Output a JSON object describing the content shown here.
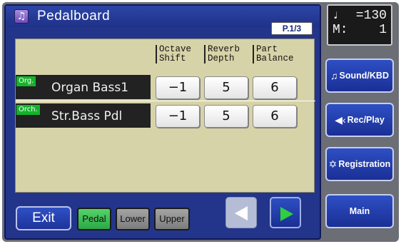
{
  "header": {
    "title": "Pedalboard",
    "page": "P.1/3",
    "icon": "music-note-icon"
  },
  "columns": [
    {
      "line1": "Octave",
      "line2": "Shift"
    },
    {
      "line1": "Reverb",
      "line2": "Depth"
    },
    {
      "line1": "Part",
      "line2": "Balance"
    }
  ],
  "rows": [
    {
      "tag": "Org.",
      "name": "Organ Bass1",
      "values": [
        "−1",
        "5",
        "6"
      ]
    },
    {
      "tag": "Orch.",
      "name": "Str.Bass Pdl",
      "values": [
        "−1",
        "5",
        "6"
      ]
    }
  ],
  "footer": {
    "exit": "Exit",
    "parts": [
      {
        "label": "Pedal",
        "active": true
      },
      {
        "label": "Lower",
        "active": false
      },
      {
        "label": "Upper",
        "active": false
      }
    ]
  },
  "tempo": {
    "note_symbol": "♩",
    "bpm_text": "=130",
    "measure_label": "M:",
    "measure": "1"
  },
  "side_buttons": [
    {
      "icon": "music-note-icon",
      "glyph": "♫",
      "label": "Sound/KBD"
    },
    {
      "icon": "speaker-icon",
      "glyph": "◀‹",
      "label": "Rec/Play"
    },
    {
      "icon": "book-icon",
      "glyph": "✡",
      "label": "Registration"
    },
    {
      "icon": "",
      "glyph": "",
      "label": "Main"
    }
  ],
  "colors": {
    "screen": "#23358a",
    "panel": "#d7d3a8",
    "tag_green": "#12b52a",
    "active_part": "#3cbf55"
  }
}
